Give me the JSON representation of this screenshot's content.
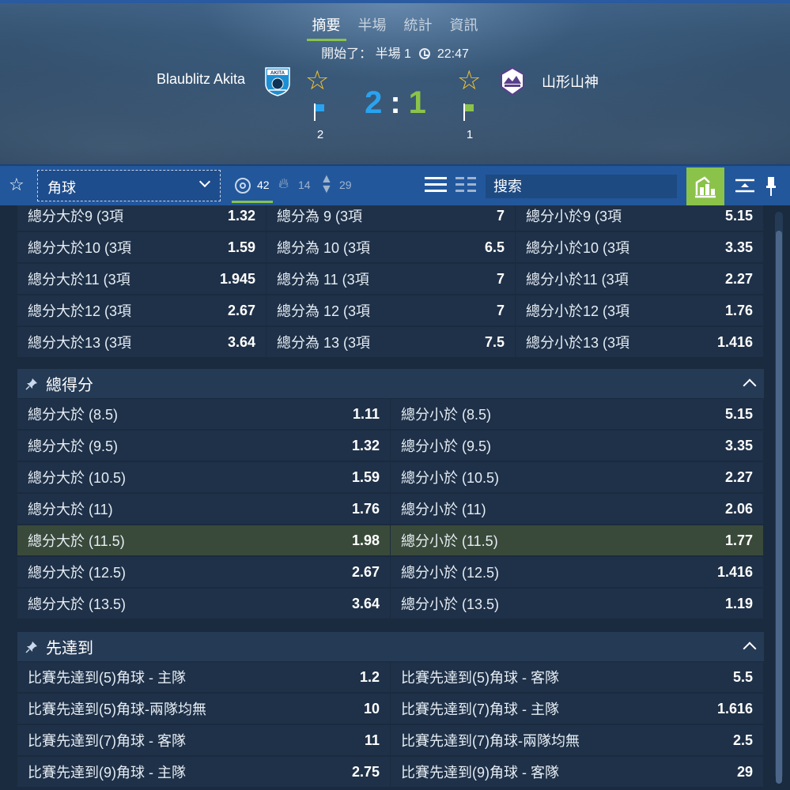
{
  "header": {
    "tabs": [
      "摘要",
      "半場",
      "統計",
      "資訊"
    ],
    "status_prefix": "開始了：",
    "period": "半場 1",
    "clock": "22:47",
    "home_team": "Blaublitz Akita",
    "away_team": "山形山神",
    "home_score": "2",
    "score_sep": ":",
    "away_score": "1",
    "home_corners": "2",
    "away_corners": "1",
    "home_crest_text": "AKITA"
  },
  "toolbar": {
    "market": "角球",
    "count_all": "42",
    "count_hot": "14",
    "count_updown": "29",
    "search_placeholder": "搜索"
  },
  "corner_totals_rows": [
    [
      [
        "總分大於9 (3項",
        "1.32"
      ],
      [
        "總分為 9 (3項",
        "7"
      ],
      [
        "總分小於9 (3項",
        "5.15"
      ]
    ],
    [
      [
        "總分大於10 (3項",
        "1.59"
      ],
      [
        "總分為 10 (3項",
        "6.5"
      ],
      [
        "總分小於10 (3項",
        "3.35"
      ]
    ],
    [
      [
        "總分大於11 (3項",
        "1.945"
      ],
      [
        "總分為 11 (3項",
        "7"
      ],
      [
        "總分小於11 (3項",
        "2.27"
      ]
    ],
    [
      [
        "總分大於12 (3項",
        "2.67"
      ],
      [
        "總分為 12 (3項",
        "7"
      ],
      [
        "總分小於12 (3項",
        "1.76"
      ]
    ],
    [
      [
        "總分大於13 (3項",
        "3.64"
      ],
      [
        "總分為 13 (3項",
        "7.5"
      ],
      [
        "總分小於13 (3項",
        "1.416"
      ]
    ]
  ],
  "total_section": {
    "title": "總得分",
    "rows": [
      [
        [
          "總分大於 (8.5)",
          "1.11"
        ],
        [
          "總分小於 (8.5)",
          "5.15"
        ]
      ],
      [
        [
          "總分大於 (9.5)",
          "1.32"
        ],
        [
          "總分小於 (9.5)",
          "3.35"
        ]
      ],
      [
        [
          "總分大於 (10.5)",
          "1.59"
        ],
        [
          "總分小於 (10.5)",
          "2.27"
        ]
      ],
      [
        [
          "總分大於 (11)",
          "1.76"
        ],
        [
          "總分小於 (11)",
          "2.06"
        ]
      ],
      [
        [
          "總分大於 (11.5)",
          "1.98"
        ],
        [
          "總分小於 (11.5)",
          "1.77"
        ]
      ],
      [
        [
          "總分大於 (12.5)",
          "2.67"
        ],
        [
          "總分小於 (12.5)",
          "1.416"
        ]
      ],
      [
        [
          "總分大於 (13.5)",
          "3.64"
        ],
        [
          "總分小於 (13.5)",
          "1.19"
        ]
      ]
    ],
    "highlight_row": 4
  },
  "race_section": {
    "title": "先達到",
    "rows": [
      [
        [
          "比賽先達到(5)角球 - 主隊",
          "1.2"
        ],
        [
          "比賽先達到(5)角球 - 客隊",
          "5.5"
        ]
      ],
      [
        [
          "比賽先達到(5)角球-兩隊均無",
          "10"
        ],
        [
          "比賽先達到(7)角球 - 主隊",
          "1.616"
        ]
      ],
      [
        [
          "比賽先達到(7)角球 - 客隊",
          "11"
        ],
        [
          "比賽先達到(7)角球-兩隊均無",
          "2.5"
        ]
      ],
      [
        [
          "比賽先達到(9)角球 - 主隊",
          "2.75"
        ],
        [
          "比賽先達到(9)角球 - 客隊",
          "29"
        ]
      ]
    ]
  },
  "colors": {
    "home": "#29a3f0",
    "away": "#8bc34a",
    "toolbar": "#22579c",
    "star": "#f4c430"
  }
}
